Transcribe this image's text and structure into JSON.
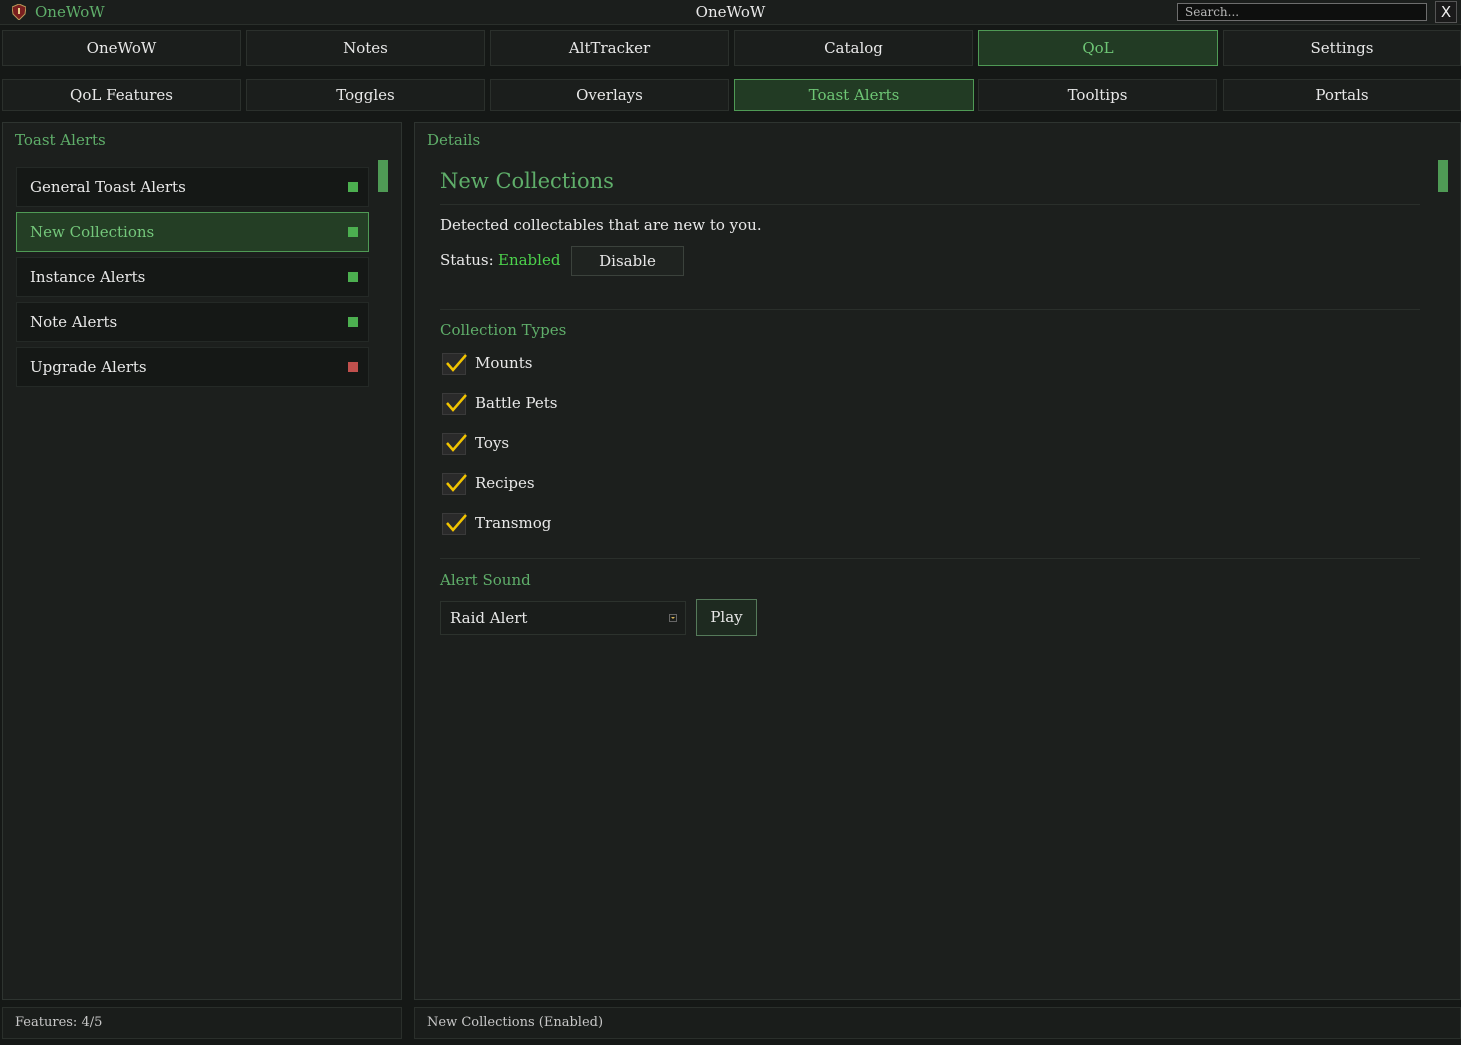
{
  "titlebar": {
    "app_name": "OneWoW",
    "window_title": "OneWoW",
    "search_placeholder": "Search...",
    "close_label": "X"
  },
  "main_tabs": [
    "OneWoW",
    "Notes",
    "AltTracker",
    "Catalog",
    "QoL",
    "Settings"
  ],
  "main_tab_active": "QoL",
  "sub_tabs": [
    "QoL Features",
    "Toggles",
    "Overlays",
    "Toast Alerts",
    "Tooltips",
    "Portals"
  ],
  "sub_tab_active": "Toast Alerts",
  "left_panel": {
    "title": "Toast Alerts",
    "items": [
      {
        "label": "General Toast Alerts",
        "status": "enabled"
      },
      {
        "label": "New Collections",
        "status": "enabled",
        "selected": true
      },
      {
        "label": "Instance Alerts",
        "status": "enabled"
      },
      {
        "label": "Note Alerts",
        "status": "enabled"
      },
      {
        "label": "Upgrade Alerts",
        "status": "disabled"
      }
    ],
    "footer": "Features: 4/5"
  },
  "details": {
    "panel_title": "Details",
    "heading": "New Collections",
    "description": "Detected collectables that are new to you.",
    "status_label": "Status:",
    "status_value": "Enabled",
    "toggle_button": "Disable",
    "collection_types_title": "Collection Types",
    "collection_types": [
      {
        "label": "Mounts",
        "checked": true
      },
      {
        "label": "Battle Pets",
        "checked": true
      },
      {
        "label": "Toys",
        "checked": true
      },
      {
        "label": "Recipes",
        "checked": true
      },
      {
        "label": "Transmog",
        "checked": true
      }
    ],
    "alert_sound_title": "Alert Sound",
    "alert_sound_value": "Raid Alert",
    "play_button": "Play",
    "footer": "New Collections (Enabled)"
  },
  "colors": {
    "accent": "#5fae6a",
    "enabled_dot": "#4caf50",
    "disabled_dot": "#c0504d",
    "status_enabled": "#4cd24c",
    "checkmark": "#f2c400"
  }
}
